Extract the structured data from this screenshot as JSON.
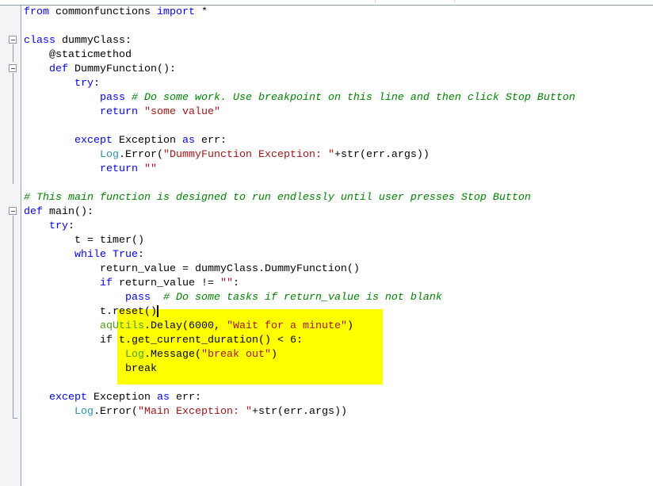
{
  "editor": {
    "lines": [
      {
        "indent": 0,
        "tokens": [
          {
            "t": "from",
            "c": "kw"
          },
          {
            "t": " commonfunctions ",
            "c": ""
          },
          {
            "t": "import",
            "c": "kw"
          },
          {
            "t": " *",
            "c": ""
          }
        ]
      },
      {
        "indent": 0,
        "tokens": []
      },
      {
        "indent": 0,
        "tokens": [
          {
            "t": "class",
            "c": "kw"
          },
          {
            "t": " dummyClass:",
            "c": ""
          }
        ]
      },
      {
        "indent": 1,
        "tokens": [
          {
            "t": "@staticmethod",
            "c": ""
          }
        ]
      },
      {
        "indent": 1,
        "tokens": [
          {
            "t": "def",
            "c": "kw"
          },
          {
            "t": " DummyFunction():",
            "c": ""
          }
        ]
      },
      {
        "indent": 2,
        "tokens": [
          {
            "t": "try",
            "c": "kw"
          },
          {
            "t": ":",
            "c": ""
          }
        ]
      },
      {
        "indent": 3,
        "tokens": [
          {
            "t": "pass",
            "c": "kw"
          },
          {
            "t": " ",
            "c": ""
          },
          {
            "t": "# Do some work. Use breakpoint on this line and then click Stop Button",
            "c": "cm"
          }
        ]
      },
      {
        "indent": 3,
        "tokens": [
          {
            "t": "return",
            "c": "kw"
          },
          {
            "t": " ",
            "c": ""
          },
          {
            "t": "\"some value\"",
            "c": "str"
          }
        ]
      },
      {
        "indent": 0,
        "tokens": []
      },
      {
        "indent": 2,
        "tokens": [
          {
            "t": "except",
            "c": "kw"
          },
          {
            "t": " Exception ",
            "c": ""
          },
          {
            "t": "as",
            "c": "kw"
          },
          {
            "t": " err:",
            "c": ""
          }
        ]
      },
      {
        "indent": 3,
        "tokens": [
          {
            "t": "Log",
            "c": "obj"
          },
          {
            "t": ".Error(",
            "c": ""
          },
          {
            "t": "\"DummyFunction Exception: \"",
            "c": "str"
          },
          {
            "t": "+str(err.args))",
            "c": ""
          }
        ]
      },
      {
        "indent": 3,
        "tokens": [
          {
            "t": "return",
            "c": "kw"
          },
          {
            "t": " ",
            "c": ""
          },
          {
            "t": "\"\"",
            "c": "str"
          }
        ]
      },
      {
        "indent": 0,
        "tokens": []
      },
      {
        "indent": 0,
        "tokens": [
          {
            "t": "# This main function is designed to run endlessly until user presses Stop Button",
            "c": "cm"
          }
        ]
      },
      {
        "indent": 0,
        "tokens": [
          {
            "t": "def",
            "c": "kw"
          },
          {
            "t": " main():",
            "c": ""
          }
        ]
      },
      {
        "indent": 1,
        "tokens": [
          {
            "t": "try",
            "c": "kw"
          },
          {
            "t": ":",
            "c": ""
          }
        ]
      },
      {
        "indent": 2,
        "tokens": [
          {
            "t": "t = timer()",
            "c": ""
          }
        ]
      },
      {
        "indent": 2,
        "tokens": [
          {
            "t": "while",
            "c": "kw"
          },
          {
            "t": " ",
            "c": ""
          },
          {
            "t": "True",
            "c": "kw"
          },
          {
            "t": ":",
            "c": ""
          }
        ]
      },
      {
        "indent": 3,
        "tokens": [
          {
            "t": "return_value = dummyClass.DummyFunction()",
            "c": ""
          }
        ]
      },
      {
        "indent": 3,
        "tokens": [
          {
            "t": "if",
            "c": "kw"
          },
          {
            "t": " return_value != ",
            "c": ""
          },
          {
            "t": "\"\"",
            "c": "str"
          },
          {
            "t": ":",
            "c": ""
          }
        ]
      },
      {
        "indent": 4,
        "tokens": [
          {
            "t": "pass",
            "c": "kw"
          },
          {
            "t": "  ",
            "c": ""
          },
          {
            "t": "# Do some tasks if return_value is not blank",
            "c": "cm"
          }
        ]
      },
      {
        "indent": 3,
        "caret": true,
        "tokens": [
          {
            "t": "t.reset()",
            "c": ""
          }
        ]
      },
      {
        "indent": 3,
        "tokens": [
          {
            "t": "aqUtils",
            "c": "objhl"
          },
          {
            "t": ".Delay(6000, ",
            "c": ""
          },
          {
            "t": "\"Wait for a minute\"",
            "c": "str"
          },
          {
            "t": ")",
            "c": ""
          }
        ]
      },
      {
        "indent": 3,
        "tokens": [
          {
            "t": "if t.get_current_duration() < 6:",
            "c": ""
          }
        ]
      },
      {
        "indent": 4,
        "tokens": [
          {
            "t": "Log",
            "c": "objhl"
          },
          {
            "t": ".Message(",
            "c": ""
          },
          {
            "t": "\"break out\"",
            "c": "str"
          },
          {
            "t": ")",
            "c": ""
          }
        ]
      },
      {
        "indent": 4,
        "tokens": [
          {
            "t": "break",
            "c": ""
          }
        ]
      },
      {
        "indent": 0,
        "tokens": []
      },
      {
        "indent": 1,
        "tokens": [
          {
            "t": "except",
            "c": "kw"
          },
          {
            "t": " Exception ",
            "c": ""
          },
          {
            "t": "as",
            "c": "kw"
          },
          {
            "t": " err:",
            "c": ""
          }
        ]
      },
      {
        "indent": 2,
        "tokens": [
          {
            "t": "Log",
            "c": "obj"
          },
          {
            "t": ".Error(",
            "c": ""
          },
          {
            "t": "\"Main Exception: \"",
            "c": "str"
          },
          {
            "t": "+str(err.args))",
            "c": ""
          }
        ]
      }
    ]
  }
}
